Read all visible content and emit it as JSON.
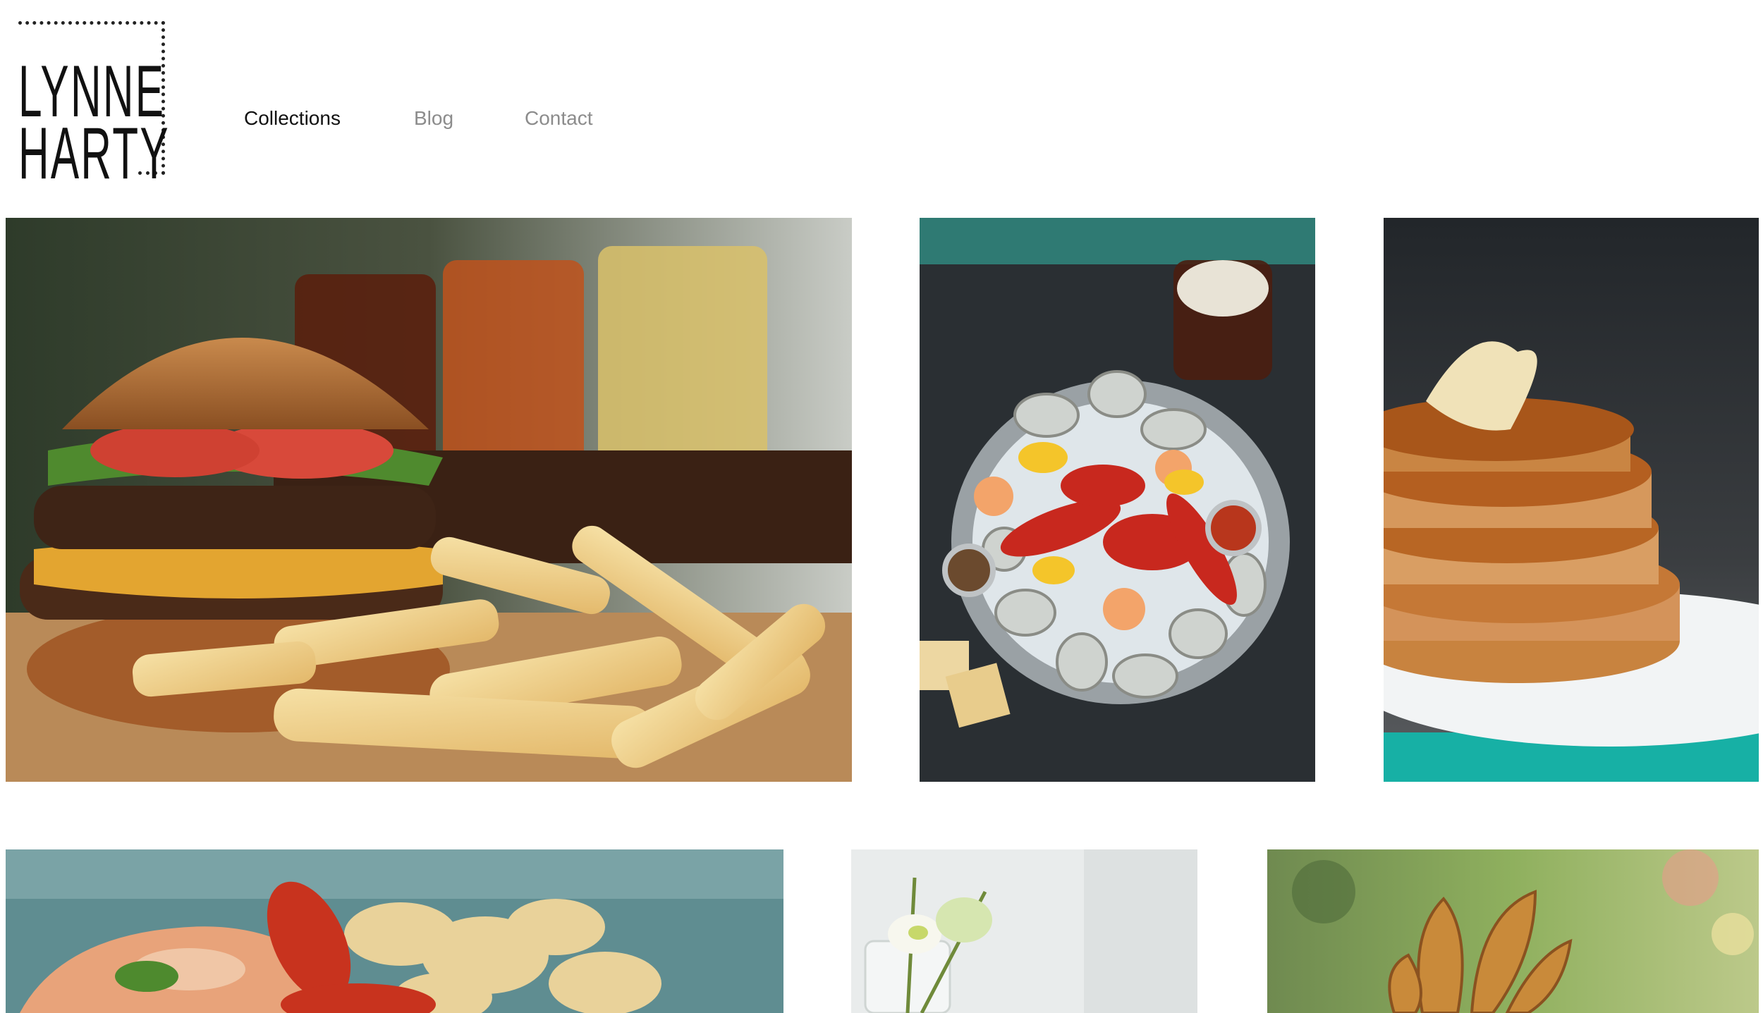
{
  "brand": {
    "line1": "LYNNE",
    "line2": "HARTY"
  },
  "nav": {
    "items": [
      {
        "label": "Collections",
        "active": true
      },
      {
        "label": "Blog",
        "active": false
      },
      {
        "label": "Contact",
        "active": false
      }
    ]
  },
  "gallery": {
    "photos": [
      {
        "subject": "burger-fries-beer"
      },
      {
        "subject": "seafood-platter"
      },
      {
        "subject": "pancakes"
      },
      {
        "subject": "lobster-roll-chips"
      },
      {
        "subject": "flowers-vase"
      },
      {
        "subject": "fried-chips"
      }
    ]
  },
  "colors": {
    "text": "#111111",
    "muted": "#8c8c8c",
    "background": "#ffffff"
  }
}
